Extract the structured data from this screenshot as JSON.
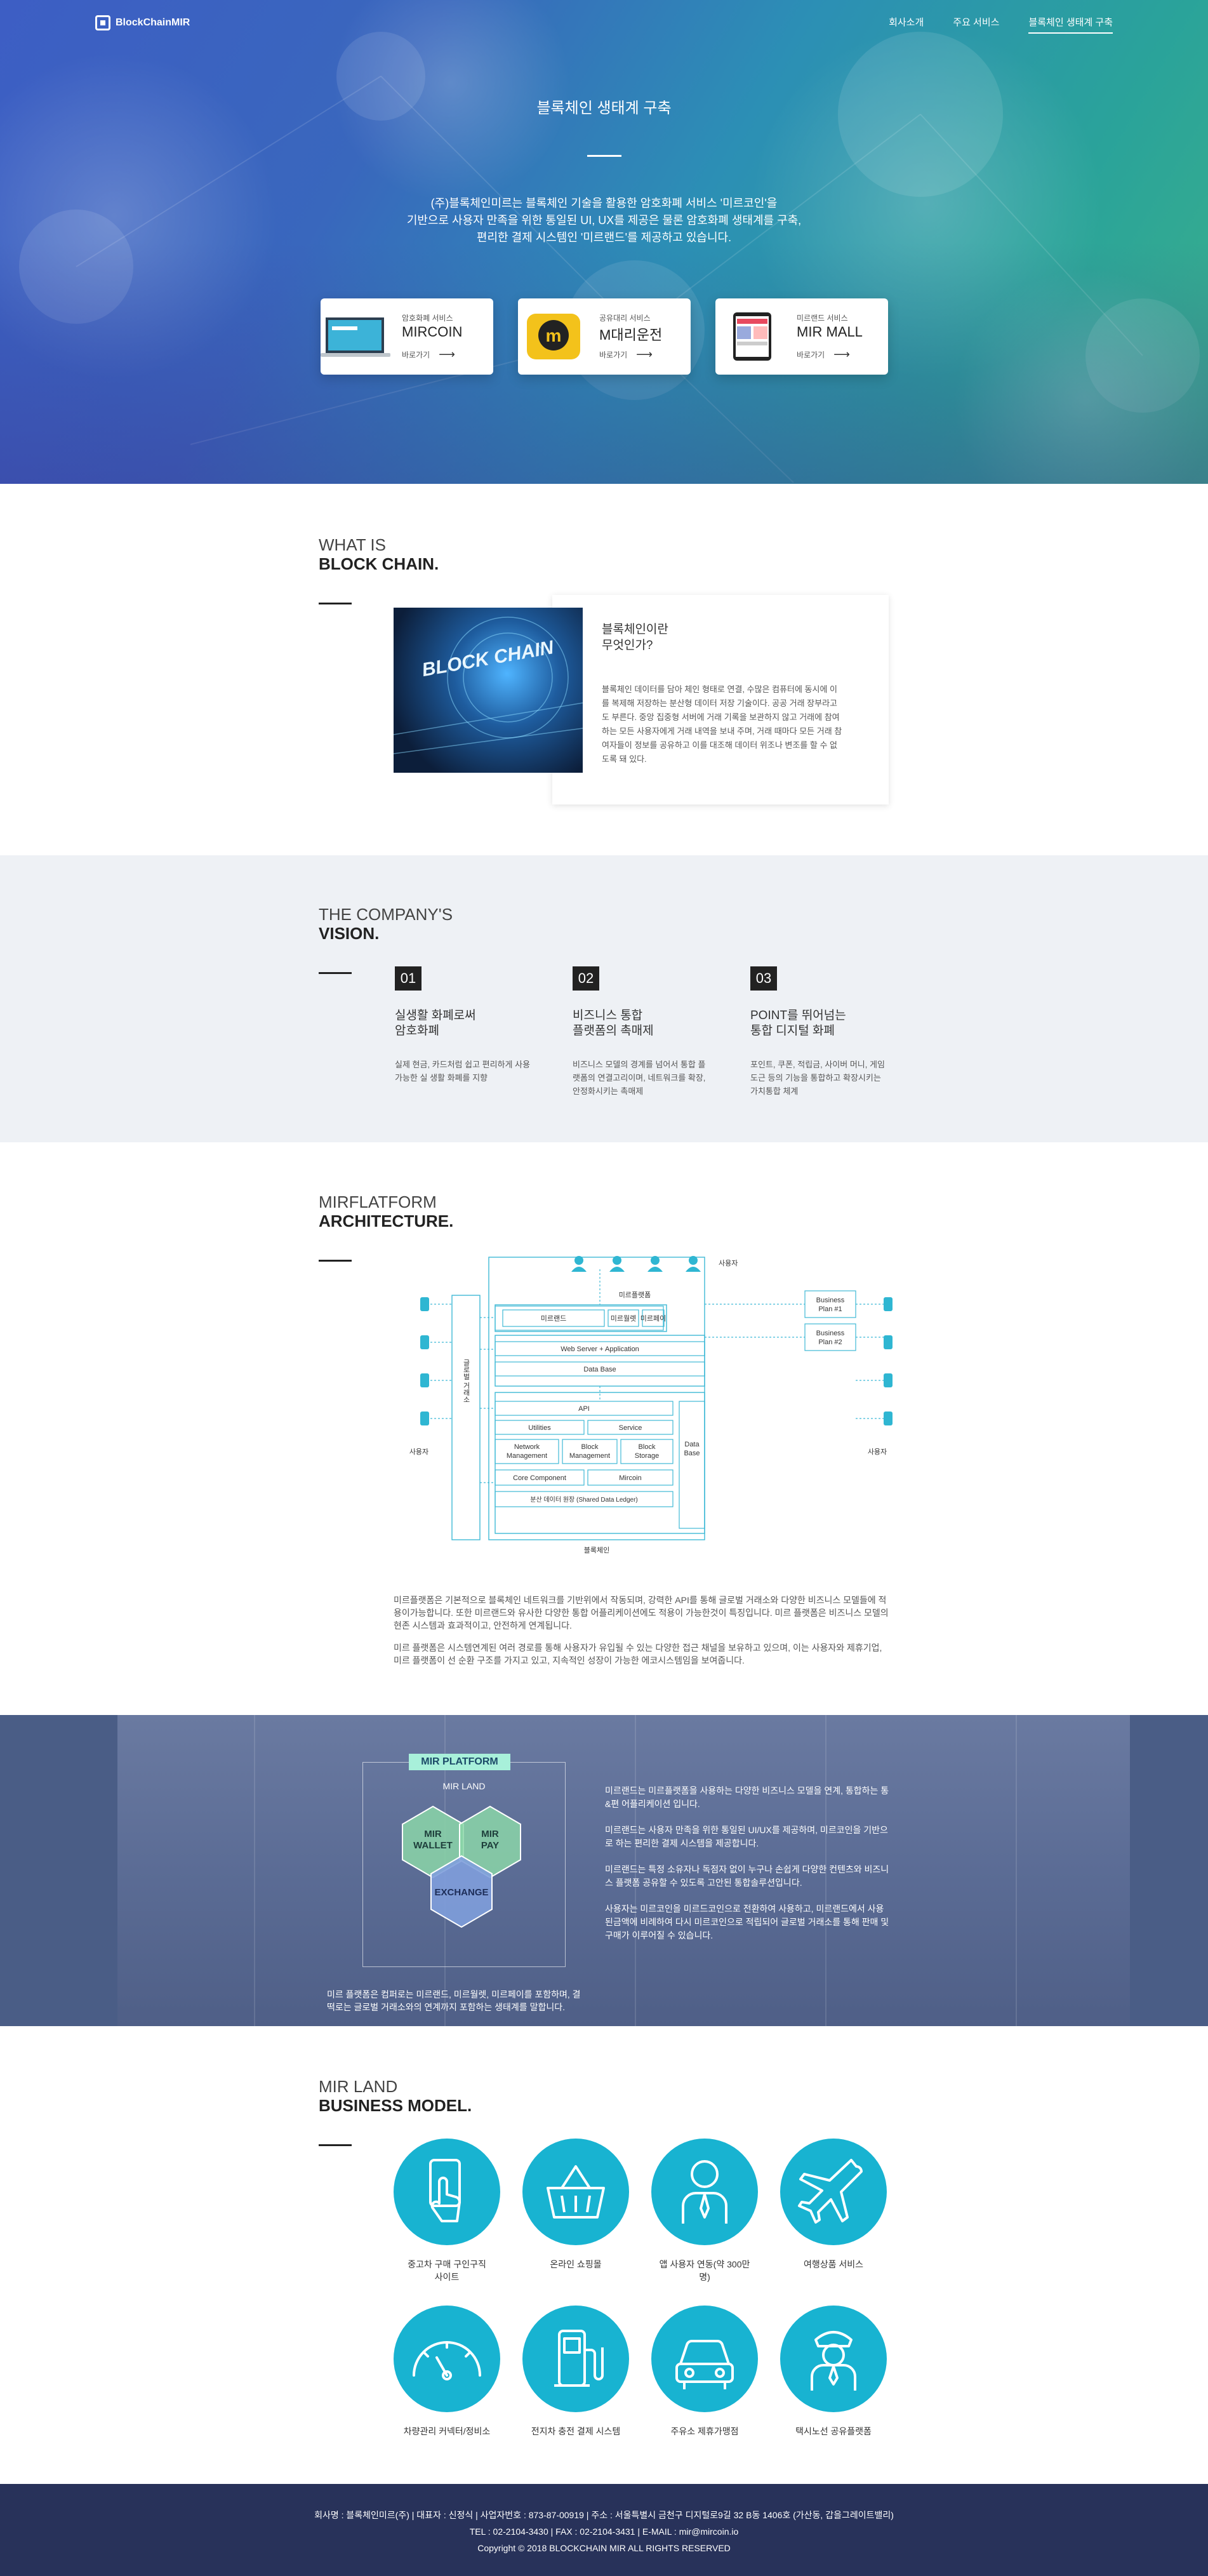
{
  "header": {
    "logo": "BlockChainMIR",
    "nav": [
      "회사소개",
      "주요 서비스",
      "블록체인 생태계 구축"
    ]
  },
  "hero": {
    "title": "블록체인 생태계 구축",
    "desc": [
      "(주)블록체인미르는 블록체인 기술을 활용한 암호화폐 서비스 '미르코인'을",
      "기반으로 사용자 만족을 위한 통일된 UI, UX를 제공은 물론 암호화폐 생태계를 구축,",
      "편리한 결제 시스템인 '미르랜드'를 제공하고 있습니다."
    ],
    "services": [
      {
        "cat": "암호화폐 서비스",
        "name": "MIRCOIN",
        "go": "바로가기"
      },
      {
        "cat": "공유대리 서비스",
        "name": "M대리운전",
        "go": "바로가기"
      },
      {
        "cat": "미르랜드 서비스",
        "name": "MIR MALL",
        "go": "바로가기"
      }
    ]
  },
  "blockchain": {
    "h1": "WHAT IS",
    "h2": "BLOCK CHAIN.",
    "image_text": "BLOCK CHAIN",
    "card_title": [
      "블록체인이란",
      "무엇인가?"
    ],
    "card_desc": "블록체인 데이터를 담아 체인 형태로 연결, 수많은 컴퓨터에 동시에 이를 복제해 저장하는 분산형 데이터 저장 기술이다. 공공 거래 장부라고도 부른다. 중앙 집중형 서버에 거래 기록을 보관하지 않고 거래에 참여하는 모든 사용자에게 거래 내역을 보내 주며, 거래 때마다 모든 거래 참여자들이 정보를 공유하고 이를 대조해 데이터 위조나 변조를 할 수 없도록 돼 있다."
  },
  "vision": {
    "h1": "THE COMPANY'S",
    "h2": "VISION.",
    "items": [
      {
        "num": "01",
        "title": [
          "실생활 화폐로써",
          "암호화폐"
        ],
        "desc": "실제 현금, 카드처럼 쉽고 편리하게 사용 가능한 실 생활 화폐를 지향"
      },
      {
        "num": "02",
        "title": [
          "비즈니스 통합",
          "플랫폼의 촉매제"
        ],
        "desc": "비즈니스 모델의 경계를 넘어서 통합 플랫폼의 연결고리이며, 네트워크를 확장, 안정화시키는 촉매제"
      },
      {
        "num": "03",
        "title": [
          "POINT를 뛰어넘는",
          "통합 디지털 화폐"
        ],
        "desc": "포인트, 쿠폰, 적립금, 사이버 머니, 게임도근 등의 기능을 통합하고 확장시키는 가치통합 체계"
      }
    ]
  },
  "architecture": {
    "h1": "MIRFLATFORM",
    "h2": "ARCHITECTURE.",
    "diagram": {
      "users_top": "사용자",
      "mir_platform": "미르플랫폼",
      "mirland": "미르랜드",
      "mirwallet": "미르월렛",
      "mirpay": "미르페이",
      "webserver": "Web Server + Application",
      "database1": "Data Base",
      "global": "글로벌 거래소",
      "api": "API",
      "utilities": "Utilities",
      "service": "Service",
      "netmgmt": [
        "Network",
        "Management"
      ],
      "blockmgmt": [
        "Block",
        "Management"
      ],
      "blockstorage": [
        "Block",
        "Storage"
      ],
      "database2": [
        "Data",
        "Base"
      ],
      "core": "Core Component",
      "mircoin": "Mircoin",
      "ledger": "분산 데이터 원장 (Shared Data Ledger)",
      "blockchain": "블록체인",
      "bp1": [
        "Business",
        "Plan #1"
      ],
      "bp2": [
        "Business",
        "Plan #2"
      ],
      "user_left": "사용자",
      "user_right": "사용자"
    },
    "p1": "미르플랫폼은 기본적으로 블록체인 네트워크를 기반위에서 작동되며, 강력한 API를 통해 글로벌 거래소와 다양한 비즈니스 모델들에 적용이가능합니다. 또한 미르랜드와 유사한 다양한 통합 어플리케이션에도 적용이 가능한것이 특징입니다. 미르 플랫폼은 비즈니스 모델의 현존 시스템과 효과적이고, 안전하게 연계됩니다.",
    "p2": "미르 플랫폼은 시스템연계된 여러 경로를 통해 사용자가 유입될 수 있는 다양한 접근 채널을 보유하고 있으며, 이는 사용자와 제휴기업, 미르 플랫폼이 선 순환 구조를 가지고 있고, 지속적인 성장이 가능한 에코시스템임을 보여줍니다."
  },
  "mirplatform": {
    "label": "MIR PLATFORM",
    "land": "MIR LAND",
    "wallet": [
      "MIR",
      "WALLET"
    ],
    "pay": [
      "MIR",
      "PAY"
    ],
    "exchange": "EXCHANGE",
    "texts": [
      "미르랜드는 미르플랫폼을 사용하는 다양한 비즈니스 모델을 연계, 통합하는 통&편 어플리케이션 입니다.",
      "미르랜드는 사용자 만족을 위한 통일된 UI/UX를 제공하며, 미르코인을 기반으로 하는 편리한 결제 시스템을 제공합니다.",
      "미르랜드는 특정 소유자나 독점자 없이 누구나 손쉽게 다양한 컨텐츠와 비즈니스 플랫폼 공유할 수 있도록 고안된 통합솔루션입니다.",
      "사용자는 미르코인을 미르드코인으로 전환하여 사용하고, 미르랜드에서 사용된금액에 비례하여 다시 미르코인으로 적립되어 글로벌 거래소를 통해 판매 및 구매가 이루어질 수 있습니다."
    ],
    "bottom": "미르 플랫폼은 컴퍼로는 미르랜드, 미르월렛, 미르페이를 포함하며, 결 떡로는 글로벌 거래소와의 연계까지 포함하는 생태계를 말합니다."
  },
  "business": {
    "h1": "MIR LAND",
    "h2": "BUSINESS MODEL.",
    "items": [
      {
        "icon": "hand-phone-icon",
        "label": [
          "중고차 구매 구인구직",
          "사이트"
        ]
      },
      {
        "icon": "shopping-basket-icon",
        "label": [
          "온라인 쇼핑몰"
        ]
      },
      {
        "icon": "businessman-icon",
        "label": [
          "앱 사용자 연동(약 300만",
          "명)"
        ]
      },
      {
        "icon": "airplane-icon",
        "label": [
          "여행상품 서비스"
        ]
      },
      {
        "icon": "speedometer-icon",
        "label": [
          "차량관리 커넥터/정비소"
        ]
      },
      {
        "icon": "ev-charger-icon",
        "label": [
          "전지차 충전 결제 시스템"
        ]
      },
      {
        "icon": "car-icon",
        "label": [
          "주유소 제휴가맹점"
        ]
      },
      {
        "icon": "driver-icon",
        "label": [
          "택시노선 공유플랫폼"
        ]
      }
    ]
  },
  "footer": {
    "l1": "회사명 : 블록체인미르(주) | 대표자 : 신정식 | 사업자번호 : 873-87-00919 | 주소 : 서울특별시 금천구 디지털로9길 32 B동 1406호 (가산동, 갑을그레이트밸리)",
    "l2": "TEL : 02-2104-3430 | FAX : 02-2104-3431 | E-MAIL : mir@mircoin.io",
    "l3": "Copyright © 2018 BLOCKCHAIN MIR ALL RIGHTS RESERVED"
  }
}
